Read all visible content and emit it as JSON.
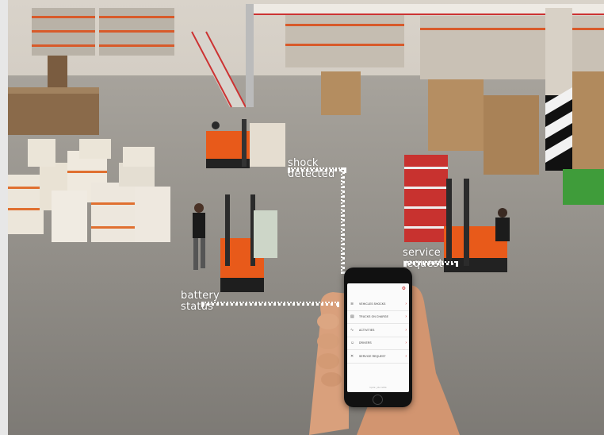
{
  "callouts": {
    "shock": [
      "shock",
      "detected"
    ],
    "service": [
      "service",
      "request"
    ],
    "battery": [
      "battery",
      "status"
    ]
  },
  "phone_app": {
    "menu": [
      {
        "label": "VEHICLES SHOCKS",
        "icon": "shock-icon"
      },
      {
        "label": "TRUCKS ON CHARGE",
        "icon": "document-icon"
      },
      {
        "label": "ACTIVITIES",
        "icon": "activity-icon"
      },
      {
        "label": "DRIVERS",
        "icon": "driver-icon"
      },
      {
        "label": "SERVICE REQUEST",
        "icon": "tools-icon"
      }
    ],
    "footer": "toyota i_site mobile"
  },
  "colors": {
    "accent": "#d32f2f",
    "forklift": "#e85a1a",
    "floor": "#8c8a86"
  }
}
